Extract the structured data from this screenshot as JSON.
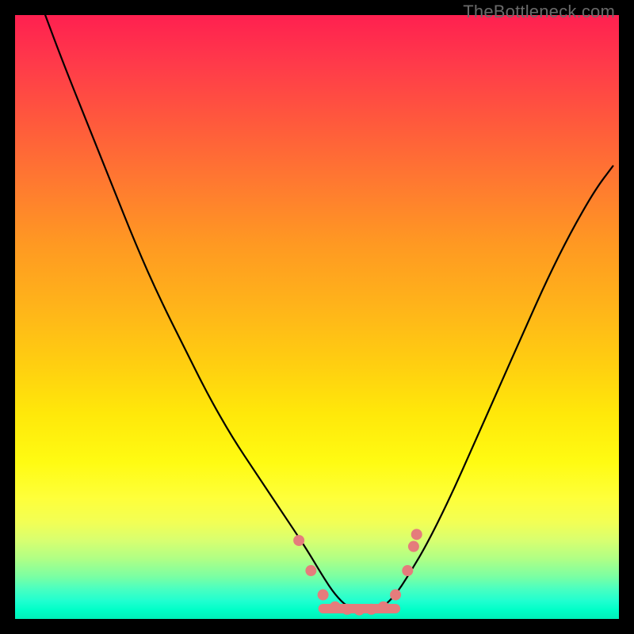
{
  "watermark": "TheBottleneck.com",
  "chart_data": {
    "type": "line",
    "title": "",
    "xlabel": "",
    "ylabel": "",
    "xlim": [
      0,
      100
    ],
    "ylim": [
      0,
      100
    ],
    "grid": false,
    "legend": false,
    "series": [
      {
        "name": "bottleneck-curve",
        "color": "#000000",
        "x": [
          5,
          8,
          12,
          16,
          20,
          24,
          28,
          32,
          36,
          40,
          44,
          48,
          51,
          53,
          55,
          57,
          59,
          61,
          63,
          65,
          68,
          72,
          76,
          80,
          84,
          88,
          92,
          96,
          99
        ],
        "y": [
          100,
          92,
          82,
          72,
          62,
          53,
          45,
          37,
          30,
          24,
          18,
          12,
          7,
          4,
          2,
          1.5,
          1.5,
          2,
          4,
          7,
          12,
          20,
          29,
          38,
          47,
          56,
          64,
          71,
          75
        ]
      },
      {
        "name": "minimum-beads",
        "type": "scatter",
        "color": "#e57c7c",
        "x": [
          47,
          49,
          51,
          53,
          55,
          57,
          59,
          61,
          63,
          65,
          66,
          66.5
        ],
        "y": [
          13,
          8,
          4,
          2,
          1.6,
          1.5,
          1.6,
          2,
          4,
          8,
          12,
          14
        ]
      },
      {
        "name": "minimum-bead-bar",
        "type": "line",
        "color": "#e57c7c",
        "x": [
          51,
          63
        ],
        "y": [
          1.7,
          1.7
        ]
      }
    ],
    "background_gradient": {
      "top": "#ff2050",
      "mid": "#ffe80a",
      "bottom": "#00f0b8"
    }
  }
}
